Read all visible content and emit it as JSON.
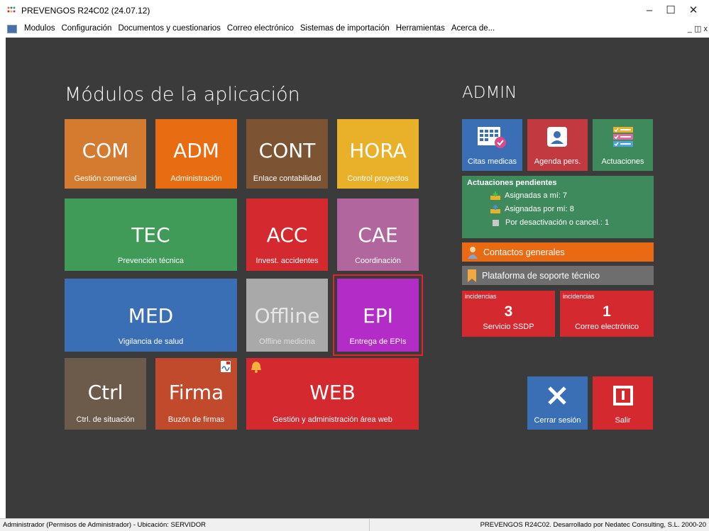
{
  "window": {
    "title": "PREVENGOS R24C02 (24.07.12)",
    "minimize_glyph": "–",
    "maximize_glyph": "☐",
    "close_glyph": "✕",
    "mdi_controls": "_ ◫ x"
  },
  "menu": {
    "items": [
      "Modulos",
      "Configuración",
      "Documentos y cuestionarios",
      "Correo electrónico",
      "Sistemas de importación",
      "Herramientas",
      "Acerca de..."
    ]
  },
  "modules": {
    "title": "Módulos de la aplicación",
    "tiles": [
      {
        "abbr": "COM",
        "sub": "Gestión comercial",
        "color": "#d57b2f"
      },
      {
        "abbr": "ADM",
        "sub": "Administración",
        "color": "#e86d12"
      },
      {
        "abbr": "CONT",
        "sub": "Enlace contabilidad",
        "color": "#7d5433"
      },
      {
        "abbr": "HORA",
        "sub": "Control proyectos",
        "color": "#e9b12a"
      },
      {
        "abbr": "TEC",
        "sub": "Prevención técnica",
        "color": "#3f9b57"
      },
      {
        "abbr": "ACC",
        "sub": "Invest. accidentes",
        "color": "#d3292f"
      },
      {
        "abbr": "CAE",
        "sub": "Coordinación",
        "color": "#b1669d"
      },
      {
        "abbr": "MED",
        "sub": "Vigilancia de salud",
        "color": "#3a6fb6"
      },
      {
        "abbr": "Offline",
        "sub": "Offline medicina",
        "color": "#a9a9a9"
      },
      {
        "abbr": "EPI",
        "sub": "Entrega de EPIs",
        "color": "#b42cc8"
      },
      {
        "abbr": "Ctrl",
        "sub": "Ctrl. de situación",
        "color": "#6c5a4b"
      },
      {
        "abbr": "Firma",
        "sub": "Buzón de firmas",
        "color": "#c24a2c"
      },
      {
        "abbr": "WEB",
        "sub": "Gestión y administración área web",
        "color": "#d3292f"
      }
    ],
    "selected_outline_color": "#e0252a"
  },
  "admin": {
    "title": "ADMIN",
    "tiles": [
      {
        "label": "Citas medicas",
        "color": "#3a6fb6",
        "icon": "calendar-icon"
      },
      {
        "label": "Agenda pers.",
        "color": "#c23a3f",
        "icon": "contact-card-icon"
      },
      {
        "label": "Actuaciones",
        "color": "#3f8a5d",
        "icon": "checklist-icon"
      }
    ],
    "pending": {
      "header": "Actuaciones pendientes",
      "rows": [
        "Asignadas a mí: 7",
        "Asignadas por mí: 8",
        "Por desactivación o cancel.: 1"
      ]
    },
    "contacts_label": "Contactos generales",
    "support_label": "Plataforma de soporte técnico",
    "incidents": [
      {
        "caption": "incidencias",
        "count": "3",
        "label": "Servicio SSDP"
      },
      {
        "caption": "incidencias",
        "count": "1",
        "label": "Correo electrónico"
      }
    ],
    "logout_label": "Cerrar sesión",
    "exit_label": "Salir"
  },
  "status": {
    "left": "Administrador  (Permisos de Administrador)  -  Ubicación: SERVIDOR",
    "right": "PREVENGOS R24C02. Desarrollado por Nedatec Consulting, S.L. 2000-20"
  }
}
